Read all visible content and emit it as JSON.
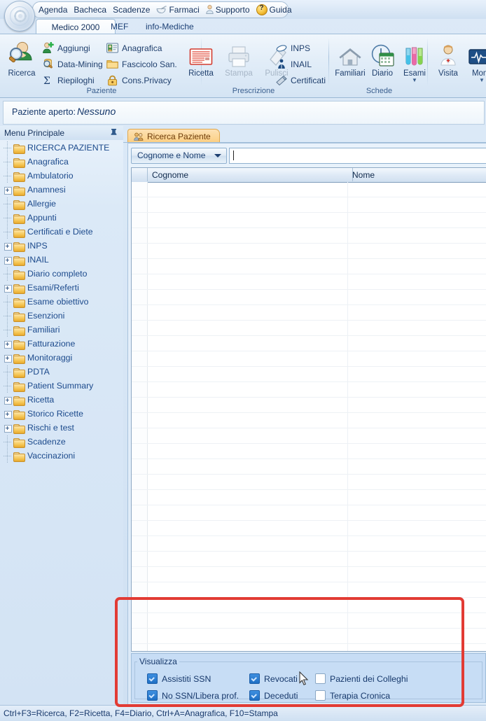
{
  "quick_access": {
    "items": [
      {
        "label": "Agenda",
        "icon": ""
      },
      {
        "label": "Bacheca",
        "icon": ""
      },
      {
        "label": "Scadenze",
        "icon": ""
      },
      {
        "label": "Farmaci",
        "icon": "pill-mortar-icon"
      },
      {
        "label": "Supporto",
        "icon": "person-support-icon"
      },
      {
        "label": "Guida",
        "icon": "help-question-icon"
      }
    ]
  },
  "ribbon": {
    "tabs": [
      {
        "label": "Medico 2000",
        "selected": true
      },
      {
        "label": "MEF",
        "selected": false
      },
      {
        "label": "info-Mediche",
        "selected": false
      }
    ],
    "groups": [
      {
        "name": "Paziente",
        "label": "Paziente",
        "big": [
          {
            "label": "Ricerca",
            "icon": "patient-search-icon",
            "disabled": false
          }
        ],
        "small": [
          {
            "label": "Aggiungi",
            "icon": "add-person-icon"
          },
          {
            "label": "Data-Mining",
            "icon": "data-mining-icon"
          },
          {
            "label": "Riepiloghi",
            "icon": "sigma-icon"
          },
          {
            "label": "Anagrafica",
            "icon": "id-card-icon"
          },
          {
            "label": "Fascicolo San.",
            "icon": "folder-icon"
          },
          {
            "label": "Cons.Privacy",
            "icon": "lock-icon"
          }
        ]
      },
      {
        "name": "Prescrizione",
        "label": "Prescrizione",
        "big": [
          {
            "label": "Ricetta",
            "icon": "prescription-icon",
            "disabled": false
          },
          {
            "label": "Stampa",
            "icon": "printer-icon",
            "disabled": true
          },
          {
            "label": "Pulisci",
            "icon": "eraser-icon",
            "disabled": true
          }
        ],
        "small": [
          {
            "label": "INPS",
            "icon": "inps-icon"
          },
          {
            "label": "INAIL",
            "icon": "inail-icon"
          },
          {
            "label": "Certificati",
            "icon": "certificate-icon"
          }
        ]
      },
      {
        "name": "Schede",
        "label": "Schede",
        "big": [
          {
            "label": "Familiari",
            "icon": "house-icon",
            "disabled": false
          },
          {
            "label": "Diario",
            "icon": "clock-calendar-icon",
            "disabled": false
          },
          {
            "label": "Esami",
            "icon": "test-tubes-icon",
            "disabled": false,
            "dropdown": true
          }
        ],
        "small": []
      },
      {
        "name": "Visite",
        "label": "",
        "big": [
          {
            "label": "Visita",
            "icon": "doctor-icon",
            "disabled": false
          },
          {
            "label": "Monit",
            "icon": "monitor-ecg-icon",
            "disabled": false,
            "dropdown": true
          }
        ],
        "small": []
      }
    ]
  },
  "open_patient": {
    "label": "Paziente aperto:",
    "value": "Nessuno"
  },
  "sidebar": {
    "title": "Menu Principale",
    "pin_icon": "pin-icon",
    "items": [
      {
        "label": "RICERCA PAZIENTE",
        "expandable": false
      },
      {
        "label": "Anagrafica",
        "expandable": false
      },
      {
        "label": "Ambulatorio",
        "expandable": false
      },
      {
        "label": "Anamnesi",
        "expandable": true
      },
      {
        "label": "Allergie",
        "expandable": false
      },
      {
        "label": "Appunti",
        "expandable": false
      },
      {
        "label": "Certificati e Diete",
        "expandable": false
      },
      {
        "label": "INPS",
        "expandable": true
      },
      {
        "label": "INAIL",
        "expandable": true
      },
      {
        "label": "Diario completo",
        "expandable": false
      },
      {
        "label": "Esami/Referti",
        "expandable": true
      },
      {
        "label": "Esame obiettivo",
        "expandable": false
      },
      {
        "label": "Esenzioni",
        "expandable": false
      },
      {
        "label": "Familiari",
        "expandable": false
      },
      {
        "label": "Fatturazione",
        "expandable": true
      },
      {
        "label": "Monitoraggi",
        "expandable": true
      },
      {
        "label": "PDTA",
        "expandable": false
      },
      {
        "label": "Patient Summary",
        "expandable": false
      },
      {
        "label": "Ricetta",
        "expandable": true
      },
      {
        "label": "Storico Ricette",
        "expandable": true
      },
      {
        "label": "Rischi e test",
        "expandable": true
      },
      {
        "label": "Scadenze",
        "expandable": false
      },
      {
        "label": "Vaccinazioni",
        "expandable": false
      }
    ]
  },
  "document": {
    "tab": {
      "label": "Ricerca Paziente",
      "icon": "patients-icon"
    },
    "search": {
      "criteria_selected": "Cognome e Nome",
      "criteria_options": [
        "Cognome e Nome"
      ],
      "input_value": "",
      "placeholder": ""
    },
    "grid": {
      "columns": [
        "Cognome",
        "Nome"
      ],
      "rows": []
    }
  },
  "visualizza": {
    "title": "Visualizza",
    "checkboxes": [
      {
        "label": "Assistiti SSN",
        "checked": true
      },
      {
        "label": "No SSN/Libera prof.",
        "checked": true
      },
      {
        "label": "Revocati",
        "checked": true
      },
      {
        "label": "Deceduti",
        "checked": true
      },
      {
        "label": "Pazienti dei Colleghi",
        "checked": false
      },
      {
        "label": "Terapia Cronica",
        "checked": false
      }
    ]
  },
  "status_bar": {
    "text": "Ctrl+F3=Ricerca, F2=Ricetta, F4=Diario, Ctrl+A=Anagrafica, F10=Stampa"
  },
  "annotation": {
    "highlight_color": "#e23b34"
  }
}
